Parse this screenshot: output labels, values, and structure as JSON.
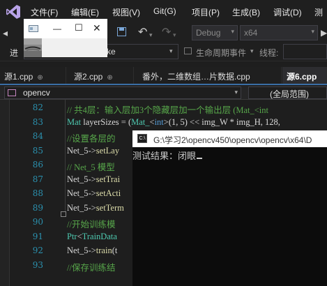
{
  "menu": {
    "items": [
      "文件(F)",
      "编辑(E)",
      "视图(V)",
      "Git(G)",
      "项目(P)",
      "生成(B)",
      "调试(D)",
      "测"
    ]
  },
  "toolbar": {
    "config_value": "Debug",
    "platform_value": "x64",
    "dropdown_arrow": "▾"
  },
  "processbar": {
    "progress_label": "进",
    "lifecycle_label": "生命周期事件",
    "lifecycle_arrow": "▾",
    "thread_label": "线程:",
    "partial_text": "ke"
  },
  "tabs": [
    {
      "label": "源1.cpp",
      "pin": "⊕"
    },
    {
      "label": "源2.cpp",
      "pin": "⊕"
    },
    {
      "label": "番外，二维数组…片数据.cpp",
      "pin": ""
    },
    {
      "label": "源6.cpp",
      "pin": ""
    }
  ],
  "navbar": {
    "scope": "opencv",
    "member": "(全局范围)"
  },
  "editor": {
    "line_numbers": [
      "82",
      "83",
      "84",
      "85",
      "86",
      "87",
      "88",
      "89",
      "90",
      "91",
      "92",
      "93"
    ],
    "lines": [
      [
        {
          "t": "// 共4层：输入层加3个隐藏层加一个输出层 (Mat_<int",
          "c": "cm"
        }
      ],
      [
        {
          "t": "Mat ",
          "c": "tp"
        },
        {
          "t": "layerSizes",
          "c": "var"
        },
        {
          "t": " = (",
          "c": "var"
        },
        {
          "t": "Mat_",
          "c": "tp"
        },
        {
          "t": "<",
          "c": "var"
        },
        {
          "t": "int",
          "c": "kw"
        },
        {
          "t": ">(1, 5) << ",
          "c": "var"
        },
        {
          "t": "img_W",
          "c": "var"
        },
        {
          "t": " * ",
          "c": "var"
        },
        {
          "t": "img_H",
          "c": "var"
        },
        {
          "t": ", 128,",
          "c": "var"
        }
      ],
      [
        {
          "t": "//设置各层的",
          "c": "cm"
        }
      ],
      [
        {
          "t": "Net_5",
          "c": "var"
        },
        {
          "t": "->",
          "c": "var"
        },
        {
          "t": "setLay",
          "c": "fn"
        }
      ],
      [
        {
          "t": "// Net_5 模型",
          "c": "cm"
        }
      ],
      [
        {
          "t": "Net_5",
          "c": "var"
        },
        {
          "t": "->",
          "c": "var"
        },
        {
          "t": "setTrai",
          "c": "fn"
        }
      ],
      [
        {
          "t": "Net_5",
          "c": "var"
        },
        {
          "t": "->",
          "c": "var"
        },
        {
          "t": "setActi",
          "c": "fn"
        }
      ],
      [
        {
          "t": "Net_5",
          "c": "var"
        },
        {
          "t": "->",
          "c": "var"
        },
        {
          "t": "setTerm",
          "c": "fn"
        }
      ],
      [
        {
          "t": "//开始训练模",
          "c": "cm"
        }
      ],
      [
        {
          "t": "Ptr",
          "c": "tp"
        },
        {
          "t": "<",
          "c": "var"
        },
        {
          "t": "TrainData",
          "c": "tp"
        }
      ],
      [
        {
          "t": "Net_5",
          "c": "var"
        },
        {
          "t": "->",
          "c": "var"
        },
        {
          "t": "train",
          "c": "fn"
        },
        {
          "t": "(t",
          "c": "var"
        }
      ],
      [
        {
          "t": "//保存训练结",
          "c": "cm"
        }
      ]
    ]
  },
  "console": {
    "title_path": "G:\\学习2\\opencv450\\opencv\\opencv\\x64\\D",
    "icon_text": "C:\\",
    "output": "测试结果：闭眼"
  },
  "image_window": {
    "minimize_glyph": "—",
    "maximize_glyph": "☐",
    "close_glyph": "✕"
  },
  "colors": {
    "accent": "#3a6ea5",
    "comment": "#57a64a",
    "type": "#4ec9b0",
    "function": "#dcdcaa",
    "keyword": "#569cd6",
    "line_number": "#2b91af"
  }
}
